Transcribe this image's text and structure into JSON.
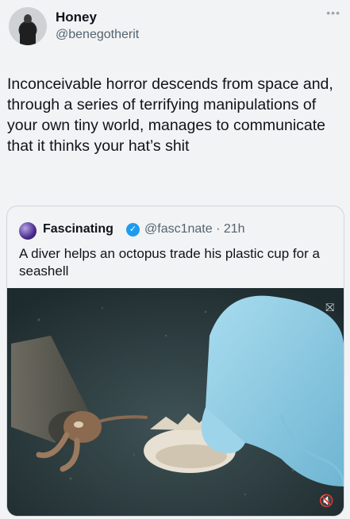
{
  "author": {
    "name": "Honey",
    "handle": "@benegotherit"
  },
  "tweet": {
    "text": "Inconceivable horror descends from space and, through a series of terrifying manipulations of your own tiny world, manages to communicate that it thinks your hat’s shit"
  },
  "quoted": {
    "name": "Fascinating",
    "verified": true,
    "handle_time": "@fasc1nate · 21h",
    "text": "A diver helps an octopus trade his plastic cup for a seashell"
  },
  "media": {
    "icons": [
      "more-icon",
      "verified-badge-icon",
      "hide-sensitive-icon",
      "volume-muted-icon"
    ]
  },
  "colors": {
    "background": "#f2f3f5",
    "text_primary": "#0f1419",
    "text_secondary": "#536471",
    "verified": "#1d9bf0"
  }
}
